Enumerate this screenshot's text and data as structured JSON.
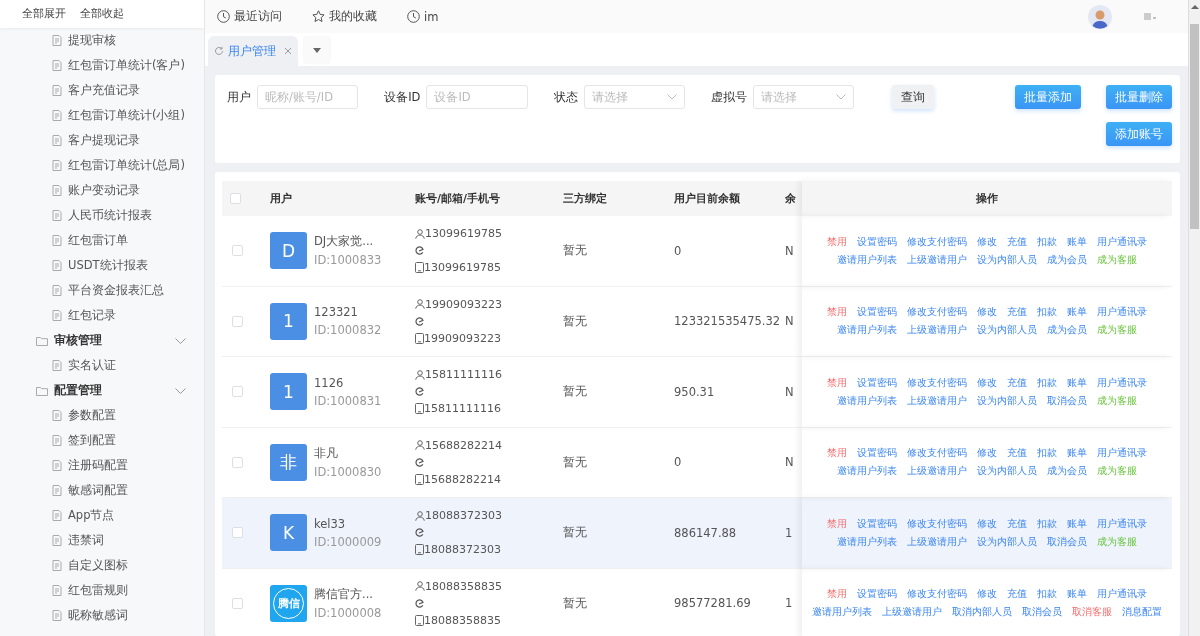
{
  "sidebar": {
    "header_links": [
      "全部展开",
      "全部收起"
    ],
    "items": [
      {
        "kind": "item",
        "label": "提现审核"
      },
      {
        "kind": "item",
        "label": "红包雷订单统计(客户)"
      },
      {
        "kind": "item",
        "label": "客户充值记录"
      },
      {
        "kind": "item",
        "label": "红包雷订单统计(小组)"
      },
      {
        "kind": "item",
        "label": "客户提现记录"
      },
      {
        "kind": "item",
        "label": "红包雷订单统计(总局)"
      },
      {
        "kind": "item",
        "label": "账户变动记录"
      },
      {
        "kind": "item",
        "label": "人民币统计报表"
      },
      {
        "kind": "item",
        "label": "红包雷订单"
      },
      {
        "kind": "item",
        "label": "USDT统计报表"
      },
      {
        "kind": "item",
        "label": "平台资金报表汇总"
      },
      {
        "kind": "item",
        "label": "红包记录"
      },
      {
        "kind": "group",
        "label": "审核管理",
        "expanded": true,
        "children": [
          {
            "kind": "item",
            "label": "实名认证"
          }
        ]
      },
      {
        "kind": "group",
        "label": "配置管理",
        "expanded": true,
        "children": [
          {
            "kind": "item",
            "label": "参数配置"
          },
          {
            "kind": "item",
            "label": "签到配置"
          },
          {
            "kind": "item",
            "label": "注册码配置"
          },
          {
            "kind": "item",
            "label": "敏感词配置"
          },
          {
            "kind": "item",
            "label": "App节点"
          },
          {
            "kind": "item",
            "label": "违禁词"
          },
          {
            "kind": "item",
            "label": "自定义图标"
          },
          {
            "kind": "item",
            "label": "红包雷规则"
          },
          {
            "kind": "item",
            "label": "昵称敏感词"
          }
        ]
      }
    ]
  },
  "topbar": {
    "links": [
      {
        "kind": "clock",
        "label": "最近访问"
      },
      {
        "kind": "star",
        "label": "我的收藏"
      },
      {
        "kind": "clock",
        "label": "im"
      }
    ]
  },
  "tabs": [
    {
      "label": "用户管理",
      "selected": true
    }
  ],
  "filters": [
    {
      "label": "用户",
      "kind": "input",
      "placeholder": "昵称/账号/ID"
    },
    {
      "label": "设备ID",
      "kind": "input",
      "placeholder": "设备ID"
    },
    {
      "label": "状态",
      "kind": "select",
      "placeholder": "请选择"
    },
    {
      "label": "虚拟号",
      "kind": "select",
      "placeholder": "请选择"
    }
  ],
  "query_button": "查询",
  "action_buttons": [
    "批量添加",
    "批量删除"
  ],
  "add_button": "添加账号",
  "table": {
    "select_all_checked": false,
    "columns": [
      "用户",
      "账号/邮箱/手机号",
      "三方绑定",
      "用户目前余额",
      "余",
      "操作"
    ],
    "rows": [
      {
        "selected": false,
        "checked": false,
        "avatar": {
          "kind": "letter",
          "text": "D"
        },
        "name": "DJ大家觉...",
        "id": "ID:1000833",
        "account": "13099619785",
        "phone": "13099619785",
        "bind": "暂无",
        "balance": "0",
        "column_5": "N",
        "actions": [
          {
            "label": "禁用",
            "kind": "danger"
          },
          {
            "label": "设置密码",
            "kind": "link"
          },
          {
            "label": "修改支付密码",
            "kind": "link"
          },
          {
            "label": "修改",
            "kind": "link"
          },
          {
            "label": "充值",
            "kind": "link"
          },
          {
            "label": "扣款",
            "kind": "link"
          },
          {
            "label": "账单",
            "kind": "link"
          },
          {
            "label": "用户通讯录",
            "kind": "link"
          },
          {
            "label": "邀请用户列表",
            "kind": "link"
          },
          {
            "label": "上级邀请用户",
            "kind": "link"
          },
          {
            "label": "设为内部人员",
            "kind": "link"
          },
          {
            "label": "成为会员",
            "kind": "link"
          },
          {
            "label": "成为客服",
            "kind": "success"
          }
        ]
      },
      {
        "selected": false,
        "checked": false,
        "avatar": {
          "kind": "letter",
          "text": "1"
        },
        "name": "123321",
        "id": "ID:1000832",
        "account": "19909093223",
        "phone": "19909093223",
        "bind": "暂无",
        "balance": "123321535475.32",
        "column_5": "N",
        "actions": [
          {
            "label": "禁用",
            "kind": "danger"
          },
          {
            "label": "设置密码",
            "kind": "link"
          },
          {
            "label": "修改支付密码",
            "kind": "link"
          },
          {
            "label": "修改",
            "kind": "link"
          },
          {
            "label": "充值",
            "kind": "link"
          },
          {
            "label": "扣款",
            "kind": "link"
          },
          {
            "label": "账单",
            "kind": "link"
          },
          {
            "label": "用户通讯录",
            "kind": "link"
          },
          {
            "label": "邀请用户列表",
            "kind": "link"
          },
          {
            "label": "上级邀请用户",
            "kind": "link"
          },
          {
            "label": "设为内部人员",
            "kind": "link"
          },
          {
            "label": "成为会员",
            "kind": "link"
          },
          {
            "label": "成为客服",
            "kind": "success"
          }
        ]
      },
      {
        "selected": false,
        "checked": false,
        "avatar": {
          "kind": "letter",
          "text": "1"
        },
        "name": "1126",
        "id": "ID:1000831",
        "account": "15811111116",
        "phone": "15811111116",
        "bind": "暂无",
        "balance": "950.31",
        "column_5": "N",
        "actions": [
          {
            "label": "禁用",
            "kind": "danger"
          },
          {
            "label": "设置密码",
            "kind": "link"
          },
          {
            "label": "修改支付密码",
            "kind": "link"
          },
          {
            "label": "修改",
            "kind": "link"
          },
          {
            "label": "充值",
            "kind": "link"
          },
          {
            "label": "扣款",
            "kind": "link"
          },
          {
            "label": "账单",
            "kind": "link"
          },
          {
            "label": "用户通讯录",
            "kind": "link"
          },
          {
            "label": "邀请用户列表",
            "kind": "link"
          },
          {
            "label": "上级邀请用户",
            "kind": "link"
          },
          {
            "label": "设为内部人员",
            "kind": "link"
          },
          {
            "label": "取消会员",
            "kind": "link"
          },
          {
            "label": "成为客服",
            "kind": "success"
          }
        ]
      },
      {
        "selected": false,
        "checked": false,
        "avatar": {
          "kind": "letter",
          "text": "非"
        },
        "name": "非凡",
        "id": "ID:1000830",
        "account": "15688282214",
        "phone": "15688282214",
        "bind": "暂无",
        "balance": "0",
        "column_5": "N",
        "actions": [
          {
            "label": "禁用",
            "kind": "danger"
          },
          {
            "label": "设置密码",
            "kind": "link"
          },
          {
            "label": "修改支付密码",
            "kind": "link"
          },
          {
            "label": "修改",
            "kind": "link"
          },
          {
            "label": "充值",
            "kind": "link"
          },
          {
            "label": "扣款",
            "kind": "link"
          },
          {
            "label": "账单",
            "kind": "link"
          },
          {
            "label": "用户通讯录",
            "kind": "link"
          },
          {
            "label": "邀请用户列表",
            "kind": "link"
          },
          {
            "label": "上级邀请用户",
            "kind": "link"
          },
          {
            "label": "设为内部人员",
            "kind": "link"
          },
          {
            "label": "成为会员",
            "kind": "link"
          },
          {
            "label": "成为客服",
            "kind": "success"
          }
        ]
      },
      {
        "selected": true,
        "checked": false,
        "avatar": {
          "kind": "letter",
          "text": "K"
        },
        "name": "kel33",
        "id": "ID:1000009",
        "account": "18088372303",
        "phone": "18088372303",
        "bind": "暂无",
        "balance": "886147.88",
        "column_5": "1",
        "actions": [
          {
            "label": "禁用",
            "kind": "danger"
          },
          {
            "label": "设置密码",
            "kind": "link"
          },
          {
            "label": "修改支付密码",
            "kind": "link"
          },
          {
            "label": "修改",
            "kind": "link"
          },
          {
            "label": "充值",
            "kind": "link"
          },
          {
            "label": "扣款",
            "kind": "link"
          },
          {
            "label": "账单",
            "kind": "link"
          },
          {
            "label": "用户通讯录",
            "kind": "link"
          },
          {
            "label": "邀请用户列表",
            "kind": "link"
          },
          {
            "label": "上级邀请用户",
            "kind": "link"
          },
          {
            "label": "设为内部人员",
            "kind": "link"
          },
          {
            "label": "取消会员",
            "kind": "link"
          },
          {
            "label": "成为客服",
            "kind": "success"
          }
        ]
      },
      {
        "selected": false,
        "checked": false,
        "avatar": {
          "kind": "logo",
          "text": "腾信"
        },
        "name": "腾信官方...",
        "id": "ID:1000008",
        "account": "18088358835",
        "phone": "18088358835",
        "bind": "暂无",
        "balance": "98577281.69",
        "column_5": "1",
        "actions": [
          {
            "label": "禁用",
            "kind": "danger"
          },
          {
            "label": "设置密码",
            "kind": "link"
          },
          {
            "label": "修改支付密码",
            "kind": "link"
          },
          {
            "label": "修改",
            "kind": "link"
          },
          {
            "label": "充值",
            "kind": "link"
          },
          {
            "label": "扣款",
            "kind": "link"
          },
          {
            "label": "账单",
            "kind": "link"
          },
          {
            "label": "用户通讯录",
            "kind": "link"
          },
          {
            "label": "邀请用户列表",
            "kind": "link"
          },
          {
            "label": "上级邀请用户",
            "kind": "link"
          },
          {
            "label": "取消内部人员",
            "kind": "link"
          },
          {
            "label": "取消会员",
            "kind": "link"
          },
          {
            "label": "取消客服",
            "kind": "danger"
          },
          {
            "label": "消息配置",
            "kind": "link"
          }
        ]
      }
    ]
  }
}
